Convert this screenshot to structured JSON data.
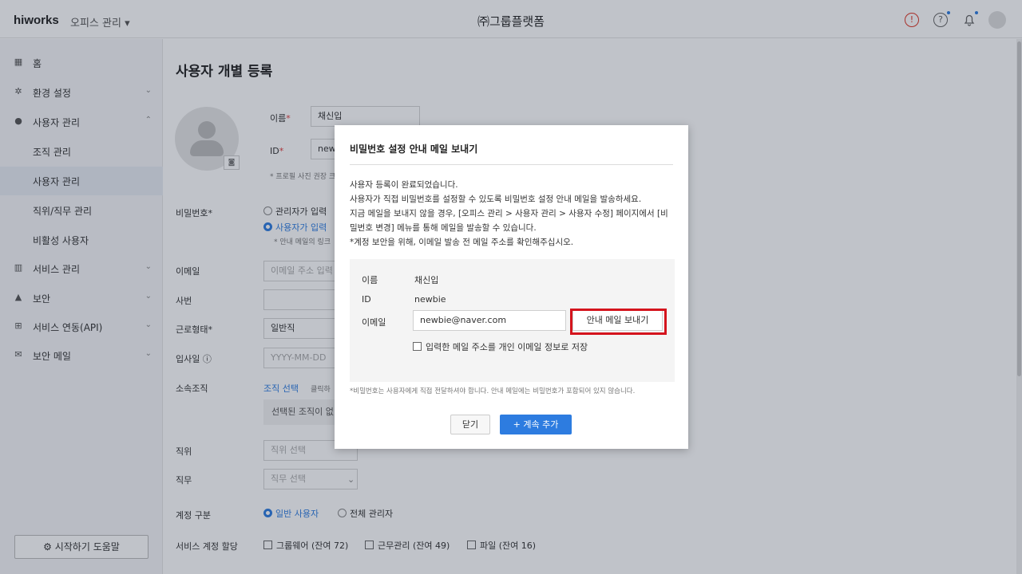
{
  "topbar": {
    "logo": "hiworks",
    "office_menu": "오피스 관리 ▾",
    "company": "㈜그룹플랫폼"
  },
  "sidebar": {
    "items": [
      {
        "label": "홈",
        "icon": "building-icon"
      },
      {
        "label": "환경 설정",
        "icon": "gear-icon"
      },
      {
        "label": "사용자 관리",
        "icon": "user-icon"
      },
      {
        "label": "조직 관리"
      },
      {
        "label": "사용자 관리"
      },
      {
        "label": "직위/직무 관리"
      },
      {
        "label": "비활성 사용자"
      },
      {
        "label": "서비스 관리",
        "icon": "chart-icon"
      },
      {
        "label": "보안",
        "icon": "lock-icon"
      },
      {
        "label": "서비스 연동(API)",
        "icon": "api-icon"
      },
      {
        "label": "보안 메일",
        "icon": "mail-icon"
      }
    ],
    "help_button": "⚙ 시작하기 도움말"
  },
  "main": {
    "title": "사용자 개별 등록",
    "name_label": "이름",
    "name_value": "채신입",
    "id_label": "ID",
    "id_value": "newbie",
    "photo_note": "* 프로필 사진 권장 크기",
    "password_label": "비밀번호*",
    "pw_option_admin": "관리자가 입력",
    "pw_option_user": "사용자가 입력",
    "pw_note": "* 안내 메일의 링크",
    "email_label": "이메일",
    "email_placeholder": "이메일 주소 입력",
    "emp_no_label": "사번",
    "work_type_label": "근로형태*",
    "work_type_value": "일반직",
    "join_date_label": "입사일 ⓘ",
    "join_date_placeholder": "YYYY-MM-DD",
    "org_label": "소속조직",
    "org_select": "조직 선택",
    "org_hint": "클릭하",
    "org_empty": "선택된 조직이 없",
    "position_label": "직위",
    "position_placeholder": "직위 선택",
    "duty_label": "직무",
    "duty_placeholder": "직무 선택",
    "account_type_label": "계정 구분",
    "account_general": "일반 사용자",
    "account_admin": "전체 관리자",
    "service_label": "서비스 계정 할당",
    "service_groupware": "그룹웨어 (잔여 72)",
    "service_attendance": "근무관리 (잔여 49)",
    "service_file": "파일 (잔여 16)"
  },
  "modal": {
    "title": "비밀번호 설정 안내 메일 보내기",
    "message_lines": [
      "사용자 등록이 완료되었습니다.",
      "사용자가 직접 비밀번호를 설정할 수 있도록 비밀번호 설정 안내 메일을 발송하세요.",
      "지금 메일을 보내지 않을 경우, [오피스 관리 > 사용자 관리 > 사용자 수정] 페이지에서 [비",
      "밀번호 변경] 메뉴를 통해 메일을 발송할 수 있습니다.",
      "*계정 보안을 위해, 이메일 발송 전 메일 주소를 확인해주십시오."
    ],
    "name_key": "이름",
    "name_value": "채신입",
    "id_key": "ID",
    "id_value": "newbie",
    "email_key": "이메일",
    "email_value": "newbie@naver.com",
    "send_button": "안내 메일 보내기",
    "save_checkbox": "입력한 메일 주소를 개인 이메일 정보로 저장",
    "footer_note": "*비밀번호는 사용자에게 직접 전달하셔야 합니다. 안내 메일에는 비밀번호가 포함되어 있지 않습니다.",
    "close_button": "닫기",
    "add_button": "+ 계속 추가"
  },
  "colors": {
    "accent": "#2d7ce0",
    "highlight": "#d4141d"
  }
}
